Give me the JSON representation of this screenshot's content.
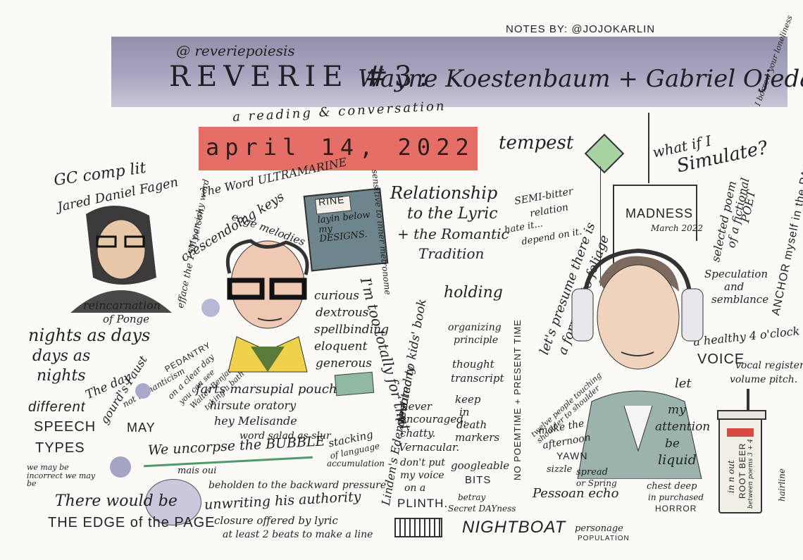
{
  "credit": "NOTES BY: @JOJOKARLIN",
  "header": {
    "handle": "@ reveriepoiesis",
    "title": "REVERIE #3:",
    "names": "Wayne Koestenbaum + Gabriel Ojeda-Sagué",
    "subtitle": "a  reading  &  conversation",
    "date": "april 14, 2022"
  },
  "notes": {
    "tempest": "tempest",
    "what_if": "what if I",
    "simulate": "Simulate?",
    "borrow": "I borrow your loneliness",
    "gc": "GC comp lit",
    "fagen": "Jared Daniel Fagen",
    "efface": "efface the 1ST person",
    "icky": "My an icky word",
    "word_ultra": "The Word ULTRAMARINE",
    "rine": "RINE",
    "layin": "layin below my DESIGNS.",
    "sensitive": "sensitive to inner metronome",
    "crescendo": "crescendoing keys",
    "edge_melodies": "edge melodies",
    "relationship": "Relationship",
    "to_lyric": "to the Lyric",
    "romantic": "+ the Romantic",
    "tradition": "Tradition",
    "semi": "SEMI-bitter",
    "relation": "relation",
    "hate": "hate it...",
    "depend": "depend on it.",
    "madness": "MADNESS",
    "march": "March 2022",
    "selected": "selected poem",
    "fictional": "of a fictional",
    "poet": "POET",
    "anchor": "ANCHOR myself in the PAGE",
    "reincarnation": "reincarnation",
    "ponge": "of Ponge",
    "curious": "curious",
    "dextrous": "dextrous",
    "spellbinding": "spellbinding",
    "eloquent": "eloquent",
    "generous": "generous",
    "too_totally": "I'm too totally for that.",
    "holding": "holding",
    "presume": "let's presume there is",
    "formula": "a formula to foliage",
    "speculation": "Speculation",
    "and": "and",
    "semblance": "semblance",
    "nights": "nights as days",
    "days_as": "days as",
    "nights2": "nights",
    "the_day": "The day",
    "faust": "gourd's Faust",
    "notromanticism": "not romanticism",
    "pedantry": "PEDANTRY",
    "clear_day": "on a clear day",
    "you_can": "you can see",
    "walter": "Walter Benjamin",
    "bath": "taking a bath",
    "organizing": "organizing",
    "principle": "principle",
    "thought": "thought",
    "transcript": "transcript",
    "poem_time": "NO POEMTIME + PRESENT TIME",
    "healthy": "a healthy 4 o'clock",
    "voice": "VOICE",
    "vocal": "vocal registers",
    "volume": "volume pitch.",
    "different": "different",
    "speech": "SPEECH",
    "types": "TYPES",
    "marsupial": "farts marsupial pouch",
    "hirsute": "hirsute oratory",
    "hey": "hey Melisande",
    "salad": "word salad as slur",
    "devoted": "devoted to kids' book",
    "linden": "Linden's Eden testimony",
    "may": "MAY",
    "uncorpse": "We uncorpse the BUBBLE",
    "mais_oui": "mais oui",
    "maybe": "we may be incorrect we may be",
    "stacking": "stacking",
    "of_lang": "of language",
    "accumulation": "accumulation",
    "never": "never",
    "encouraged": "encouraged.",
    "chatty": "chatty.",
    "vernacular": "Vernacular.",
    "dont_put": "don't put",
    "my_voice": "my voice",
    "on_a": "on a",
    "plinth": "PLINTH.",
    "keep": "keep",
    "in": "in",
    "death": "death",
    "markers": "markers",
    "googleable": "googleable",
    "bits": "BITS",
    "betray": "betray",
    "secret": "Secret DAYness",
    "twelve": "twelve people touching shoulder to shoulder",
    "make_the": "make the",
    "afternoon": "afternoon",
    "yawn": "YAWN",
    "sizzle": "sizzle",
    "spread": "spread",
    "or_spring": "or Spring",
    "let": "let",
    "my": "my",
    "attention": "attention",
    "be": "be",
    "liquid": "liquid",
    "inn_out": "in n out",
    "root_beer": "ROOT BEER",
    "between": "between poems 3 + 4",
    "hairline": "hairline",
    "there": "There would be",
    "edge_of": "THE EDGE of the PAGE",
    "beholden": "beholden to the backward pressure",
    "unwriting": "unwriting his authority",
    "closure": "closure offered by lyric",
    "two_beats": "at least 2 beats to make a line",
    "nightboat": "NIGHTBOAT",
    "pessoan": "Pessoan echo",
    "personage": "personage",
    "population": "POPULATION",
    "chest": "chest deep",
    "in_purchased": "in purchased",
    "horror": "HORROR"
  },
  "colors": {
    "banner": "#9796b2",
    "date_band": "#e56f66",
    "ink": "#222222",
    "book": "#6f858c",
    "tie": "#8fb9a1",
    "kite": "#a7d3a3"
  }
}
